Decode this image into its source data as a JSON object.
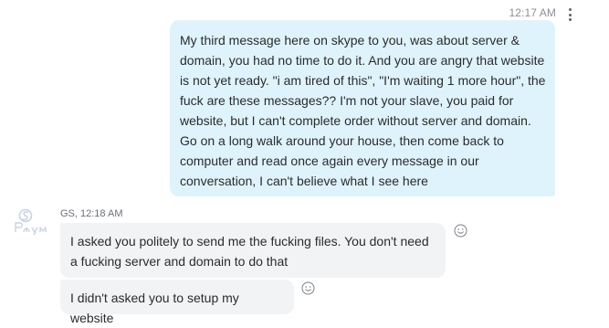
{
  "conversation": {
    "outgoing_timestamp": "12:17 AM",
    "outgoing_message": "My third message here on skype to you, was about server & domain, you had no time to do it. And you are angry that website is not yet ready. \"i am tired of this\", \"I'm waiting 1 more hour\", the fuck are these messages?? I'm not your slave, you paid for website, but I can't complete order without server and domain. Go on a long walk around your house, then come back to computer and read once again every message in our conversation, I can't believe what I see here",
    "incoming_sender": "GS, 12:18 AM",
    "incoming_messages": [
      "I asked you politely to send me the fucking files. You don't need a fucking server and domain to do that",
      "I didn't asked you to setup my website"
    ]
  },
  "icons": {
    "more": "more-vertical-icon",
    "reaction": "smiley-icon",
    "avatar": "contact-avatar"
  },
  "colors": {
    "outgoing_bubble": "#dff3fd",
    "incoming_bubble": "#f2f3f5",
    "meta_text": "#8a8f95"
  }
}
